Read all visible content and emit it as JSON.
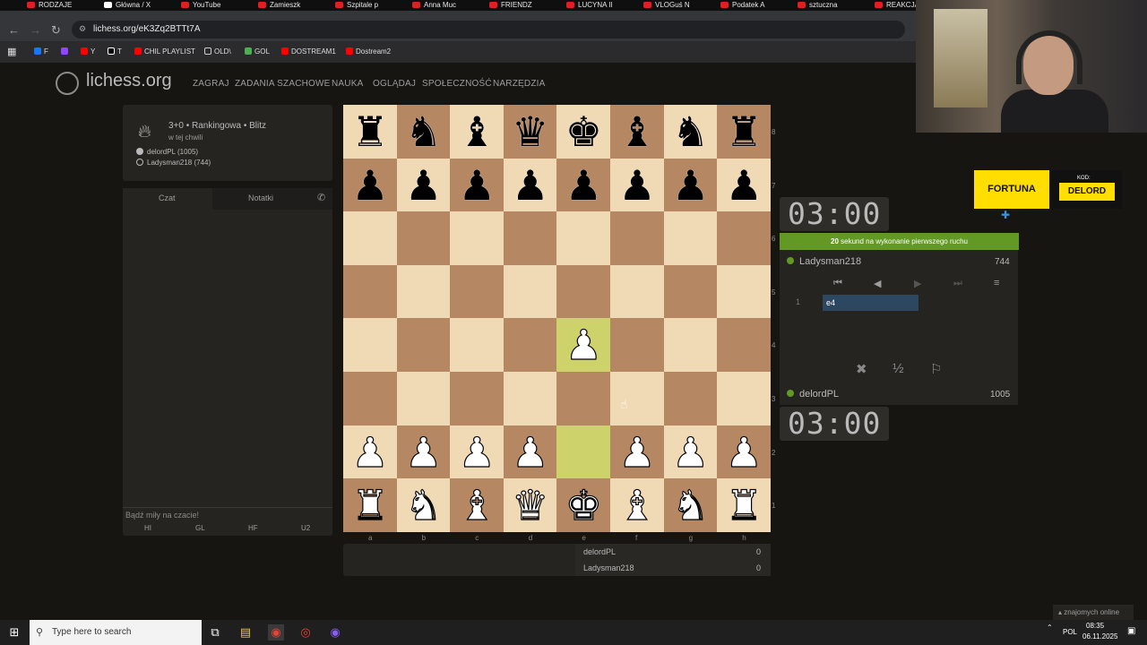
{
  "browser": {
    "tabs": [
      "RODZAJE",
      "Główna / X",
      "YouTube",
      "Zamieszk",
      "Szpitale p",
      "Anna Muc",
      "FRIENDZ",
      "LUCYNA II",
      "VLOGuś N",
      "Podatek A",
      "sztuczna",
      "REAKCJA"
    ],
    "url": "lichess.org/eK3Zq2BTTt7A",
    "bookmarks": [
      "F",
      "Y",
      "T",
      "CHIL PLAYLIST",
      "OLD\\",
      "GOL",
      "DOSTREAM1",
      "Dostream2"
    ]
  },
  "site": {
    "logo": "lichess.org",
    "nav": [
      "ZAGRAJ",
      "ZADANIA SZACHOWE",
      "NAUKA",
      "OGLĄDAJ",
      "SPOŁECZNOŚĆ",
      "NARZĘDZIA"
    ]
  },
  "game": {
    "title": "3+0 • Rankingowa • Blitz",
    "time_ago": "w tej chwili",
    "white_player": "delordPL (1005)",
    "black_player": "Ladysman218 (744)"
  },
  "chat": {
    "tab_chat": "Czat",
    "tab_notes": "Notatki",
    "placeholder": "Bądź miły na czacie!",
    "presets": [
      "HI",
      "GL",
      "HF",
      "U2"
    ]
  },
  "board": {
    "ranks": [
      "8",
      "7",
      "6",
      "5",
      "4",
      "3",
      "2",
      "1"
    ],
    "files": [
      "a",
      "b",
      "c",
      "d",
      "e",
      "f",
      "g",
      "h"
    ],
    "position": [
      "rnbqkbnr",
      "pppppppp",
      "........",
      "........",
      "....P...",
      "........",
      "PPPP.PPP",
      "RNBQKBNR"
    ],
    "light_color": "#f0d9b5",
    "dark_color": "#b58863",
    "last_move": [
      "e2",
      "e4"
    ]
  },
  "score": {
    "rows": [
      {
        "name": "delordPL",
        "score": "0"
      },
      {
        "name": "Ladysman218",
        "score": "0"
      }
    ]
  },
  "clocks": {
    "top": "03:00",
    "bottom": "03:00"
  },
  "notice": {
    "bold": "20",
    "text": " sekund na wykonanie pierwszego ruchu"
  },
  "opponent": {
    "name": "Ladysman218",
    "rating": "744"
  },
  "player": {
    "name": "delordPL",
    "rating": "1005"
  },
  "moves": [
    {
      "num": "1",
      "white": "e4"
    }
  ],
  "promo": {
    "brand": "FORTUNA",
    "kod_label": "KOD:",
    "code": "DELORD"
  },
  "friends": "znajomych online",
  "taskbar": {
    "search_placeholder": "Type here to search",
    "lang": "POL",
    "time": "08:35",
    "date": "06.11.2025"
  }
}
